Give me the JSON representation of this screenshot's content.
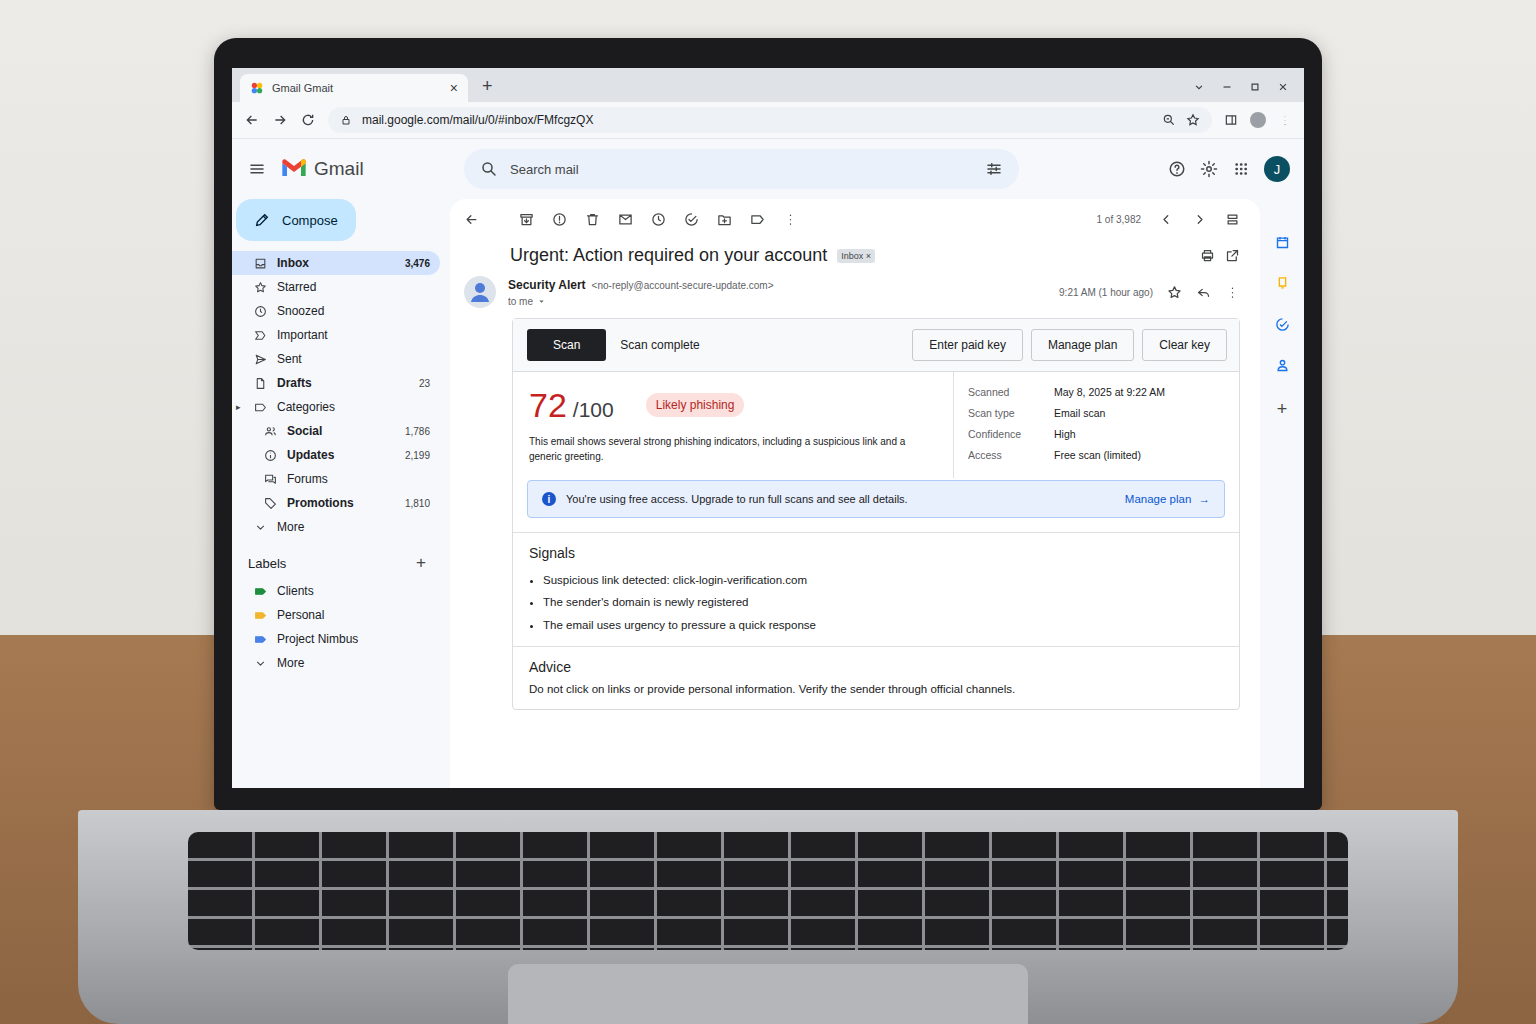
{
  "browser": {
    "tab_title": "Gmail Gmait",
    "tab_close": "×",
    "new_tab": "+",
    "url": "mail.google.com/mail/u/0/#inbox/FMfcgzQX"
  },
  "header": {
    "app_name": "Gmail",
    "search_placeholder": "Search mail",
    "avatar": "J"
  },
  "sidebar": {
    "compose": "Compose",
    "items": [
      {
        "label": "Inbox",
        "count": "3,476",
        "kind": "inbox",
        "selected": true,
        "bold": true,
        "indent": false
      },
      {
        "label": "Starred",
        "kind": "star",
        "selected": false,
        "bold": false,
        "indent": false
      },
      {
        "label": "Snoozed",
        "kind": "clock",
        "selected": false,
        "bold": false,
        "indent": false
      },
      {
        "label": "Important",
        "kind": "important",
        "selected": false,
        "bold": false,
        "indent": false
      },
      {
        "label": "Sent",
        "kind": "send",
        "selected": false,
        "bold": false,
        "indent": false
      },
      {
        "label": "Drafts",
        "count": "23",
        "kind": "file",
        "selected": false,
        "bold": true,
        "indent": false
      },
      {
        "label": "Categories",
        "caret": "▸",
        "kind": "label",
        "selected": false,
        "bold": false,
        "indent": false
      },
      {
        "label": "Social",
        "count": "1,786",
        "kind": "people",
        "selected": false,
        "bold": true,
        "indent": true
      },
      {
        "label": "Updates",
        "count": "2,199",
        "kind": "info",
        "selected": false,
        "bold": true,
        "indent": true
      },
      {
        "label": "Forums",
        "kind": "forum",
        "selected": false,
        "bold": false,
        "indent": true
      },
      {
        "label": "Promotions",
        "count": "1,810",
        "kind": "tag",
        "selected": false,
        "bold": true,
        "indent": true
      },
      {
        "label": "More",
        "kind": "chevron",
        "selected": false,
        "bold": false,
        "indent": false
      }
    ],
    "labels_title": "Labels",
    "labels_add": "+",
    "labels": [
      {
        "label": "Clients",
        "color": "#1e8e3e"
      },
      {
        "label": "Personal",
        "color": "#f2b62d"
      },
      {
        "label": "Project Nimbus",
        "color": "#4a80e8"
      }
    ],
    "labels_more": "More"
  },
  "toolbar": {
    "pager": "1 of 3,982"
  },
  "message": {
    "subject": "Urgent: Action required on your account",
    "tag": "Inbox",
    "tag_remove": "×",
    "sender_name": "Security Alert",
    "sender_email": "<no-reply@account-secure-update.com>",
    "recipient": "to me",
    "time": "9:21 AM (1 hour ago)"
  },
  "scanner": {
    "scan_button": "Scan",
    "status": "Scan complete",
    "actions": [
      "Enter paid key",
      "Manage plan",
      "Clear key"
    ],
    "score": "72",
    "score_max": "/100",
    "verdict": "Likely phishing",
    "summary": "This email shows several strong phishing indicators, including a suspicious link and a generic greeting.",
    "details": [
      {
        "label": "Scanned",
        "value": "May 8, 2025 at 9:22 AM"
      },
      {
        "label": "Scan type",
        "value": "Email scan"
      },
      {
        "label": "Confidence",
        "value": "High"
      },
      {
        "label": "Access",
        "value": "Free scan (limited)"
      }
    ],
    "banner": {
      "icon": "i",
      "text": "You're using free access. Upgrade to run full scans and see all details.",
      "link": "Manage plan",
      "arrow": "→"
    },
    "signals_title": "Signals",
    "signals": [
      "Suspicious link detected: click-login-verification.com",
      "The sender's domain is newly registered",
      "The email uses urgency to pressure a quick response"
    ],
    "advice_title": "Advice",
    "advice": "Do not click on links or provide personal information. Verify the sender through official channels."
  },
  "rail": {
    "add": "+"
  }
}
